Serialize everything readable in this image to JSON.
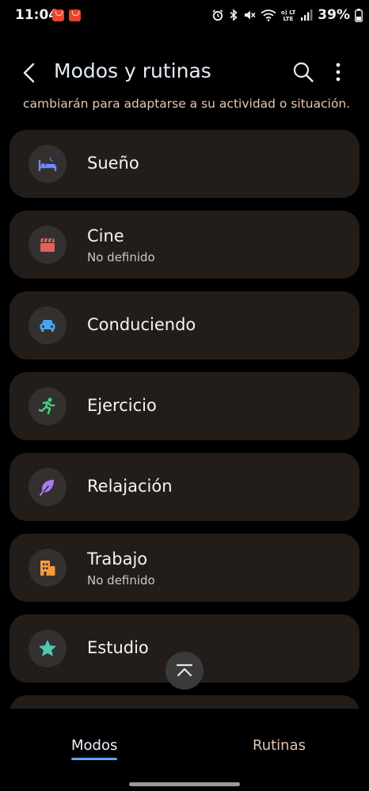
{
  "status_bar": {
    "time": "11:04",
    "battery": "39%",
    "network_label": "Vo) LTE"
  },
  "app_bar": {
    "title": "Modos y rutinas"
  },
  "intro": {
    "text": "cambiarán para adaptarse a su actividad o situación."
  },
  "modes": [
    {
      "name": "Sueño",
      "status": "",
      "icon": "bed-icon",
      "color": "#6c8bff"
    },
    {
      "name": "Cine",
      "status": "No definido",
      "icon": "clapperboard-icon",
      "color": "#e0605a"
    },
    {
      "name": "Conduciendo",
      "status": "",
      "icon": "car-icon",
      "color": "#4aa3ef"
    },
    {
      "name": "Ejercicio",
      "status": "",
      "icon": "running-icon",
      "color": "#3fcf7a"
    },
    {
      "name": "Relajación",
      "status": "",
      "icon": "leaf-icon",
      "color": "#a87cf0"
    },
    {
      "name": "Trabajo",
      "status": "No definido",
      "icon": "building-icon",
      "color": "#f59a3c"
    },
    {
      "name": "Estudio",
      "status": "",
      "icon": "star-icon",
      "color": "#4fc7b5"
    }
  ],
  "bottom_nav": {
    "tabs": [
      {
        "label": "Modos",
        "active": true
      },
      {
        "label": "Rutinas",
        "active": false
      }
    ]
  },
  "colors": {
    "background": "#000000",
    "card": "#231d1a",
    "accent": "#5fa6ff"
  }
}
